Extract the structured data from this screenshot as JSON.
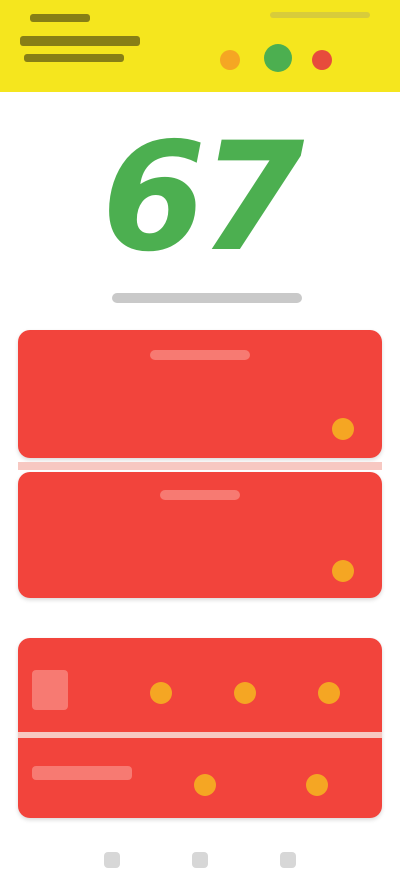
{
  "header": {
    "app_title": "",
    "status_badges": [
      {
        "name": "status-badge-orange",
        "color": "#f5a623"
      },
      {
        "name": "status-badge-green",
        "color": "#4caf50"
      },
      {
        "name": "status-badge-red",
        "color": "#e74c3c"
      }
    ]
  },
  "score": {
    "value": "67",
    "color": "#4caf50",
    "caption": ""
  },
  "cards": [
    {
      "title": "",
      "left_label": "",
      "right_label": "",
      "indicator_color": "#f5a623"
    },
    {
      "title": "",
      "left_label": "",
      "right_label": "",
      "indicator_color": "#f5a623"
    }
  ],
  "stat_panel": {
    "rows": [
      {
        "label": "",
        "indicators": [
          "#f5a623",
          "#f5a623",
          "#f5a623"
        ]
      },
      {
        "label": "",
        "indicators": [
          "#f5a623",
          "#f5a623"
        ]
      }
    ]
  },
  "colors": {
    "header_bg": "#f5e61e",
    "card_bg": "#f2443c",
    "accent": "#f5a623"
  },
  "bottom_nav": {
    "items": [
      "back-icon",
      "home-icon",
      "menu-icon"
    ]
  }
}
